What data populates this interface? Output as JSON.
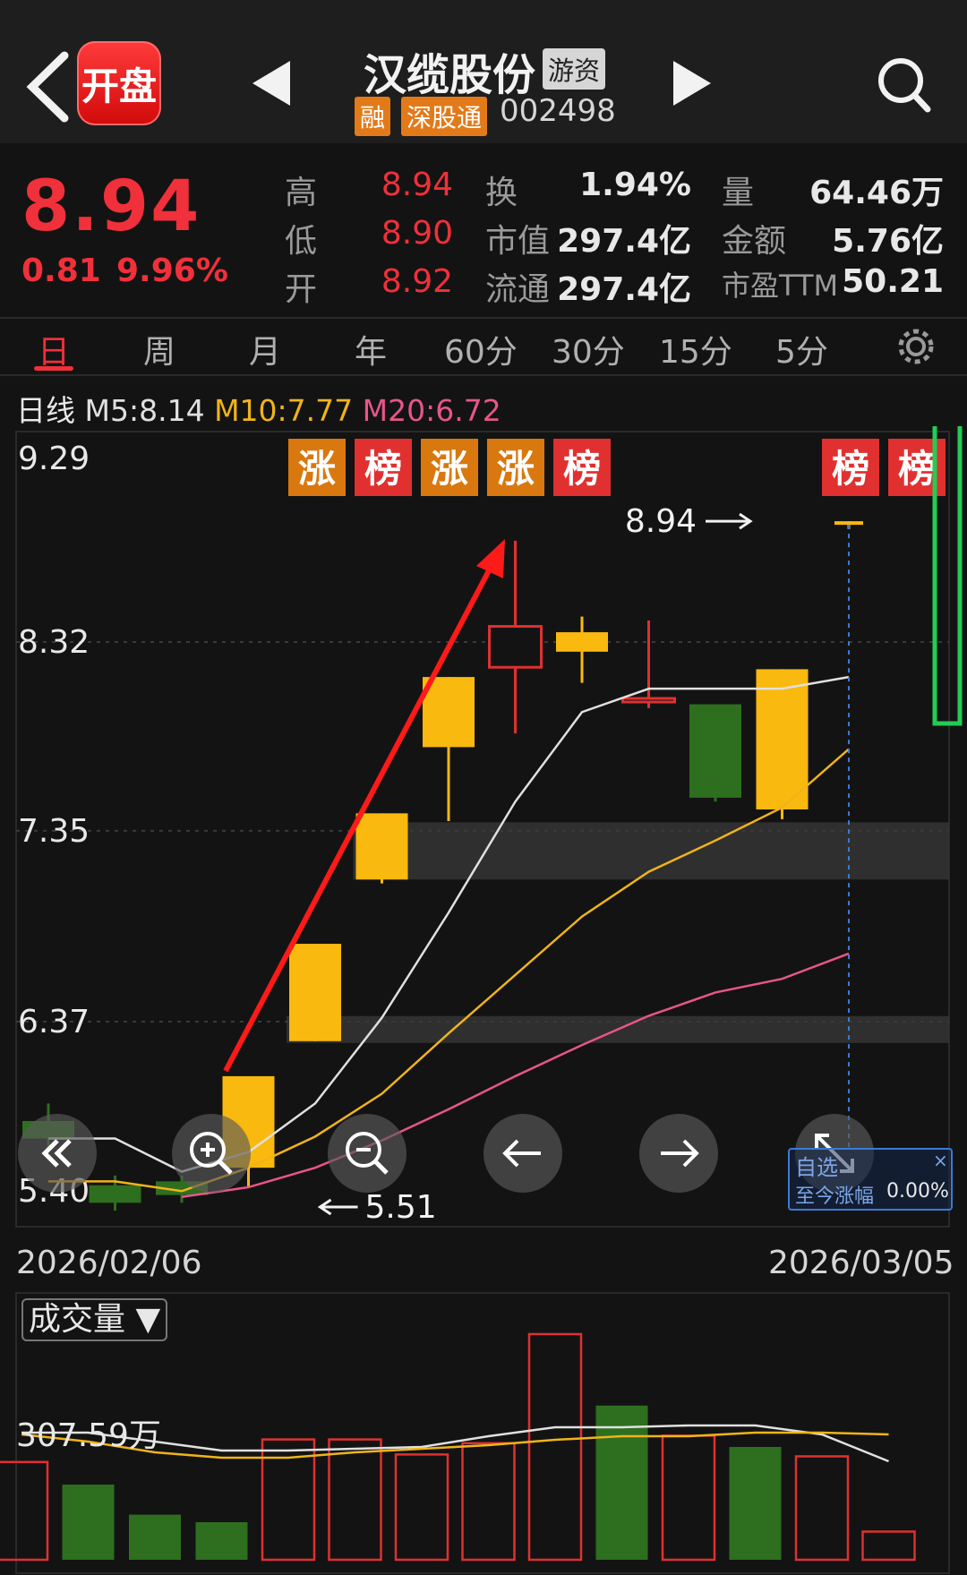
{
  "header": {
    "logo_label": "开盘",
    "stock_name": "汉缆股份",
    "tag_youzi": "游资",
    "tag_rong": "融",
    "tag_sgt": "深股通",
    "code": "002498"
  },
  "quote": {
    "price": "8.94",
    "change": "0.81",
    "change_pct": "9.96%",
    "high_label": "高",
    "high": "8.94",
    "low_label": "低",
    "low": "8.90",
    "open_label": "开",
    "open": "8.92",
    "turnover_label": "换",
    "turnover": "1.94%",
    "mktcap_label": "市值",
    "mktcap": "297.4亿",
    "float_label": "流通",
    "float": "297.4亿",
    "volume_label": "量",
    "volume": "64.46万",
    "amount_label": "金额",
    "amount": "5.76亿",
    "pe_label": "市盈TTM",
    "pe": "50.21"
  },
  "tabs": [
    "日",
    "周",
    "月",
    "年",
    "60分",
    "30分",
    "15分",
    "5分"
  ],
  "ma": {
    "prefix": "日线",
    "m5": "M5:8.14",
    "m10": "M10:7.77",
    "m20": "M20:6.72",
    "colors": {
      "m5": "#e0e0e0",
      "m10": "#f0b419",
      "m20": "#e8558a"
    }
  },
  "chart_data": {
    "type": "candlestick",
    "y_ticks": [
      "9.29",
      "8.32",
      "7.35",
      "6.37",
      "5.40"
    ],
    "ylim": [
      5.4,
      9.29
    ],
    "dates": [
      "2026/02/06",
      "2026/03/05"
    ],
    "candles": [
      {
        "o": 5.86,
        "c": 5.77,
        "h": 5.95,
        "l": 5.7
      },
      {
        "o": 5.53,
        "c": 5.44,
        "h": 5.58,
        "l": 5.4
      },
      {
        "o": 5.55,
        "c": 5.48,
        "h": 5.58,
        "l": 5.44
      },
      {
        "o": 5.62,
        "c": 6.09,
        "h": 6.09,
        "l": 5.52
      },
      {
        "o": 6.27,
        "c": 6.77,
        "h": 6.77,
        "l": 6.27
      },
      {
        "o": 7.1,
        "c": 7.44,
        "h": 7.44,
        "l": 7.08
      },
      {
        "o": 7.78,
        "c": 8.14,
        "h": 8.14,
        "l": 7.4
      },
      {
        "o": 8.19,
        "c": 8.4,
        "h": 8.84,
        "l": 7.85
      },
      {
        "o": 8.27,
        "c": 8.37,
        "h": 8.45,
        "l": 8.11
      },
      {
        "o": 8.03,
        "c": 8.03,
        "h": 8.43,
        "l": 7.98
      },
      {
        "o": 8.0,
        "c": 7.52,
        "h": 8.0,
        "l": 7.5
      },
      {
        "o": 7.46,
        "c": 8.18,
        "h": 8.18,
        "l": 7.41
      },
      {
        "o": 8.92,
        "c": 8.94,
        "h": 8.94,
        "l": 8.9
      }
    ],
    "ma_m5": [
      5.77,
      5.77,
      5.6,
      5.7,
      5.95,
      6.39,
      6.93,
      7.5,
      7.96,
      8.08,
      8.08,
      8.08,
      8.14
    ],
    "ma_m10": [
      5.55,
      5.55,
      5.5,
      5.62,
      5.78,
      6.0,
      6.31,
      6.61,
      6.91,
      7.14,
      7.3,
      7.47,
      7.77
    ],
    "ma_m20": [
      5.47,
      5.52,
      5.62,
      5.76,
      5.92,
      6.09,
      6.25,
      6.4,
      6.52,
      6.59,
      6.72
    ],
    "badges": [
      {
        "text": "涨",
        "color": "#d9780e"
      },
      {
        "text": "榜",
        "color": "#e03030"
      },
      {
        "text": "涨",
        "color": "#d9780e"
      },
      {
        "text": "涨",
        "color": "#d9780e"
      },
      {
        "text": "榜",
        "color": "#e03030"
      },
      {
        "text": "榜",
        "color": "#e03030"
      },
      {
        "text": "榜",
        "color": "#e03030"
      }
    ],
    "price_marker_high": "8.94",
    "price_marker_low": "5.51",
    "volume_max_label": "307.59万",
    "volumes": [
      {
        "v": 0.52,
        "up": true
      },
      {
        "v": 0.4,
        "up": false
      },
      {
        "v": 0.24,
        "up": false
      },
      {
        "v": 0.2,
        "up": false
      },
      {
        "v": 0.64,
        "up": true
      },
      {
        "v": 0.64,
        "up": true
      },
      {
        "v": 0.56,
        "up": true
      },
      {
        "v": 0.62,
        "up": true
      },
      {
        "v": 1.2,
        "up": true
      },
      {
        "v": 0.82,
        "up": false
      },
      {
        "v": 0.66,
        "up": true
      },
      {
        "v": 0.6,
        "up": false
      },
      {
        "v": 0.55,
        "up": true
      },
      {
        "v": 0.15,
        "up": true
      }
    ]
  },
  "volume": {
    "selector_label": "成交量"
  },
  "widget": {
    "line1": "自选",
    "line2": "至今涨幅",
    "value": "0.00%",
    "close": "×"
  }
}
